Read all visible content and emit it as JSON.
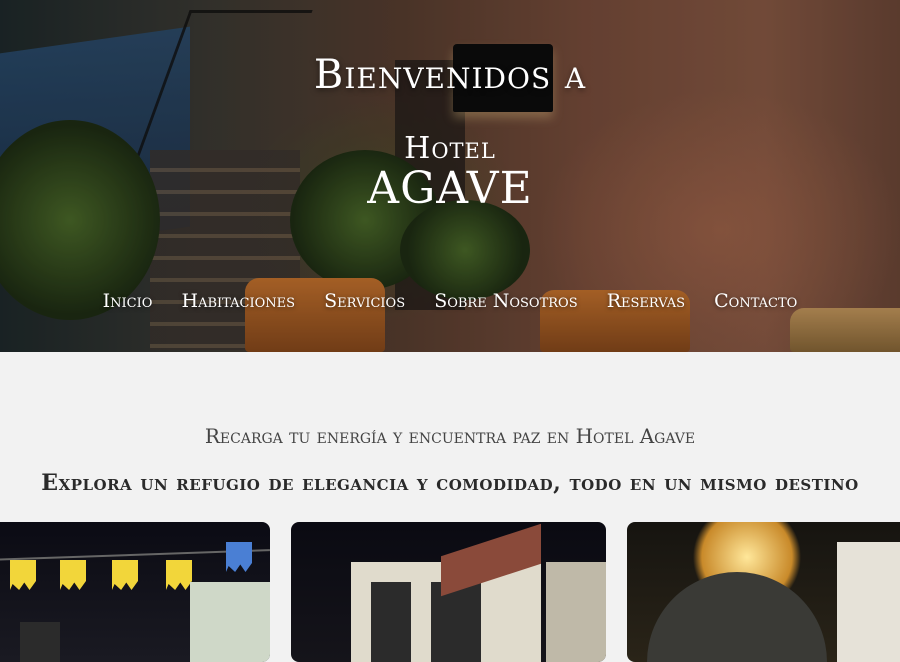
{
  "hero": {
    "welcome": "Bienvenidos a",
    "logo_line1": "Hotel",
    "logo_line2": "AGAVE"
  },
  "nav": {
    "items": [
      "Inicio",
      "Habitaciones",
      "Servicios",
      "Sobre Nosotros",
      "Reservas",
      "Contacto"
    ]
  },
  "intro": {
    "tagline": "Recarga tu energía y encuentra paz en Hotel Agave",
    "subheading": "Explora un refugio de elegancia y comodidad, todo en un mismo destino"
  },
  "colors": {
    "page_background": "#f2f2f2",
    "hero_text": "#ffffff",
    "tagline_text": "#444444",
    "subheading_text": "#2a2a2a"
  },
  "icons": {
    "logo": "hotel-agave-logo"
  }
}
